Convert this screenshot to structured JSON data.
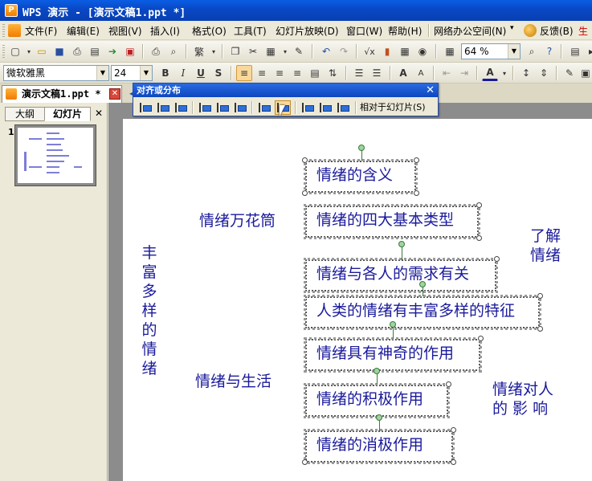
{
  "window": {
    "title": "WPS 演示 - [演示文稿1.ppt *]"
  },
  "menu": {
    "items": [
      "文件(F)",
      "编辑(E)",
      "视图(V)",
      "插入(I)",
      "格式(O)",
      "工具(T)",
      "幻灯片放映(D)",
      "窗口(W)",
      "帮助(H)",
      "网络办公空间(N)",
      "反馈(B)",
      "生"
    ],
    "dropdown_arrow": "▾"
  },
  "toolbar": {
    "zoom": "64 %",
    "font_name": "微软雅黑",
    "font_size": "24",
    "bold": "B",
    "italic": "I",
    "underline": "U",
    "shadow": "S",
    "font_grow": "A",
    "font_shrink": "A"
  },
  "document_tab": {
    "label": "演示文稿1.ppt *"
  },
  "panel_tabs": {
    "outline": "大纲",
    "slides": "幻灯片",
    "close": "✕"
  },
  "thumbnail": {
    "number": "1"
  },
  "align_toolbar": {
    "title": "对齐或分布",
    "close": "✕",
    "relative_label": "相对于幻灯片(S)"
  },
  "slide": {
    "left_vertical": [
      "丰",
      "富",
      "多",
      "样",
      "的",
      "情",
      "绪"
    ],
    "group1_label": "情绪万花筒",
    "group2_label": "情绪与生活",
    "right_top": [
      "了解",
      "情绪"
    ],
    "right_bottom": [
      "情绪对人",
      "的 影 响"
    ],
    "boxes": [
      "情绪的含义",
      "情绪的四大基本类型",
      "情绪与各人的需求有关",
      "人类的情绪有丰富多样的特征",
      "情绪具有神奇的作用",
      "情绪的积极作用",
      "情绪的消极作用"
    ]
  },
  "colors": {
    "accent_blue": "#1a1a9c",
    "titlebar": "#0a5ee4"
  }
}
